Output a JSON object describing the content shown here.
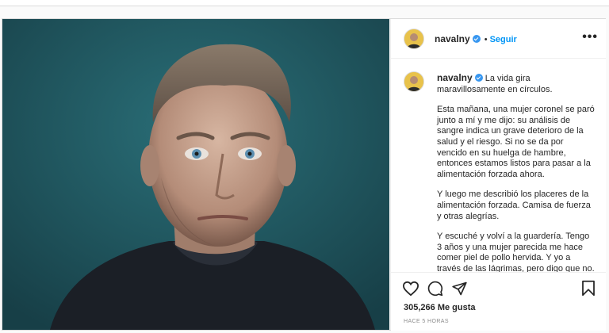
{
  "post": {
    "username": "navalny",
    "follow_label": "Seguir",
    "more_label": "•••",
    "caption": {
      "username": "navalny",
      "first_line": "La vida gira maravillosamente en círculos.",
      "paragraphs": [
        "Esta mañana, una mujer coronel se paró junto a mí y me dijo: su análisis de sangre indica un grave deterioro de la salud y el riesgo. Si no se da por vencido en su huelga de hambre, entonces estamos listos para pasar a la alimentación forzada ahora.",
        "Y luego me describió los placeres de la alimentación forzada. Camisa de fuerza y otras alegrías.",
        "Y escuché y volví a la guardería. Tengo 3 años y una mujer parecida me hace comer piel de pollo hervida. Y yo a través de las lágrimas, pero digo que no. Y la mujer también promete"
      ]
    },
    "likes": "305,266 Me gusta",
    "time": "HACE 5 HORAS"
  },
  "icons": {
    "like": "heart-icon",
    "comment": "comment-icon",
    "share": "share-icon",
    "save": "bookmark-icon",
    "verified": "verified-badge-icon"
  },
  "colors": {
    "photo_background": "#1e5a63",
    "link_blue": "#0095f6",
    "verified_blue": "#3897f0"
  }
}
